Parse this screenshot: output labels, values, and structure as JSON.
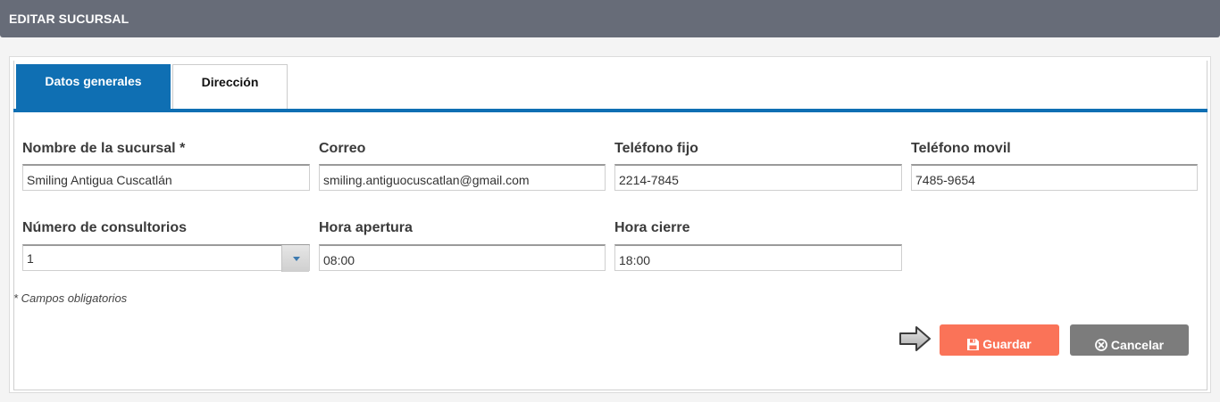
{
  "header": {
    "title": "EDITAR SUCURSAL"
  },
  "tabs": [
    {
      "label": "Datos generales",
      "active": true
    },
    {
      "label": "Dirección",
      "active": false
    }
  ],
  "form": {
    "nombre": {
      "label": "Nombre de la sucursal *",
      "value": "Smiling Antigua Cuscatlán"
    },
    "correo": {
      "label": "Correo",
      "value": "smiling.antiguocuscatlan@gmail.com"
    },
    "telefono_fijo": {
      "label": "Teléfono fijo",
      "value": "2214-7845"
    },
    "telefono_movil": {
      "label": "Teléfono movil",
      "value": "7485-9654"
    },
    "consultorios": {
      "label": "Número de consultorios",
      "value": "1"
    },
    "hora_apertura": {
      "label": "Hora apertura",
      "value": "08:00"
    },
    "hora_cierre": {
      "label": "Hora cierre",
      "value": "18:00"
    }
  },
  "note": "* Campos obligatorios",
  "actions": {
    "save_label": "Guardar",
    "cancel_label": "Cancelar",
    "save_icon": "floppy-disk-icon",
    "cancel_icon": "circle-x-icon"
  },
  "colors": {
    "header": "#676c78",
    "tab_active": "#0f6fb3",
    "save": "#fa7358",
    "cancel": "#7c7c7c"
  }
}
